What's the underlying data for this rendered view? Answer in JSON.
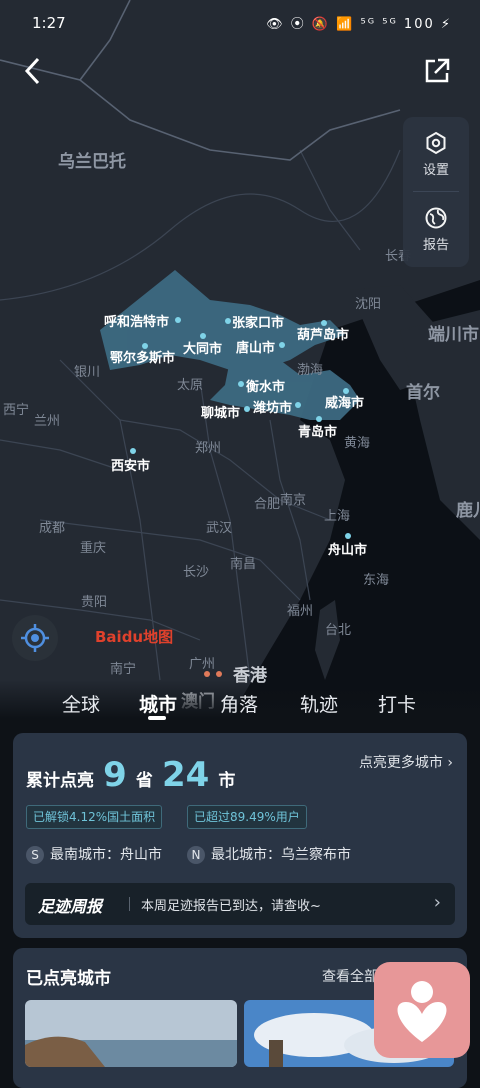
{
  "status_bar": {
    "time": "1:27",
    "icons": "👁 ⦿ 🔕 📶 ⁵ᴳ ⁵ᴳ 100 ⚡"
  },
  "side_panel": {
    "settings": "设置",
    "report": "报告"
  },
  "map": {
    "places": [
      {
        "name": "乌兰巴托",
        "big": true
      },
      {
        "name": "长春"
      },
      {
        "name": "沈阳"
      },
      {
        "name": "渤海"
      },
      {
        "name": "端川市",
        "big": true
      },
      {
        "name": "首尔",
        "big": true
      },
      {
        "name": "银川"
      },
      {
        "name": "太原"
      },
      {
        "name": "西宁"
      },
      {
        "name": "兰州"
      },
      {
        "name": "郑州"
      },
      {
        "name": "黄海"
      },
      {
        "name": "合肥"
      },
      {
        "name": "南京"
      },
      {
        "name": "上海"
      },
      {
        "name": "鹿儿",
        "big": true
      },
      {
        "name": "成都"
      },
      {
        "name": "武汉"
      },
      {
        "name": "重庆"
      },
      {
        "name": "南昌"
      },
      {
        "name": "长沙"
      },
      {
        "name": "东海"
      },
      {
        "name": "贵阳"
      },
      {
        "name": "福州"
      },
      {
        "name": "台北"
      },
      {
        "name": "广州"
      },
      {
        "name": "南宁"
      },
      {
        "name": "香港",
        "big": true
      },
      {
        "name": "澳门",
        "big": true
      }
    ],
    "cities": [
      "呼和浩特市",
      "张家口市",
      "葫芦岛市",
      "大同市",
      "唐山市",
      "鄂尔多斯市",
      "衡水市",
      "聊城市",
      "潍坊市",
      "威海市",
      "青岛市",
      "西安市",
      "舟山市"
    ],
    "baidu_logo": "Baidu地图"
  },
  "tabs": [
    "全球",
    "城市",
    "角落",
    "轨迹",
    "打卡"
  ],
  "active_tab": "城市",
  "summary": {
    "prefix": "累计点亮",
    "provinces": "9",
    "province_unit": "省",
    "cities": "24",
    "city_unit": "市",
    "more_link": "点亮更多城市",
    "chip1": "已解锁4.12%国土面积",
    "chip2": "已超过89.49%用户",
    "south_badge": "S",
    "south_text": "最南城市：舟山市",
    "north_badge": "N",
    "north_text": "最北城市：乌兰察布市",
    "weekly_title": "足迹周报",
    "weekly_text": "本周足迹报告已到达，请查收~"
  },
  "lit_cities": {
    "title": "已点亮城市",
    "view_all": "查看全部"
  },
  "colors": {
    "accent": "#7fd3e8",
    "region": "#3d6a82",
    "card": "#2a3545",
    "float": "#e79798"
  }
}
